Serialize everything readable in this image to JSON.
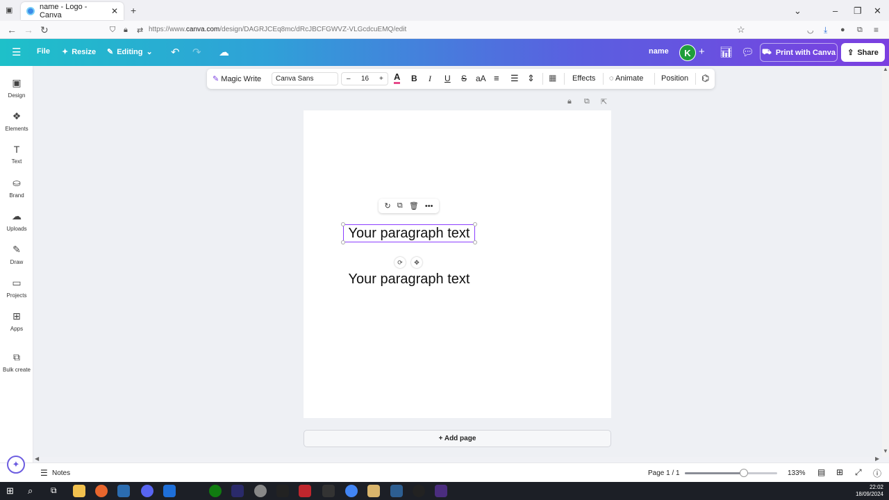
{
  "browser": {
    "tab_title": "name - Logo - Canva",
    "tab_close": "✕",
    "new_tab": "+",
    "url_prefix": "https://www.",
    "url_domain": "canva.com",
    "url_path": "/design/DAGRJCEq8mc/dRcJBCFGWVZ-VLGcdcuEMQ/edit"
  },
  "header": {
    "file_label": "File",
    "resize_label": "Resize",
    "editing_label": "Editing",
    "design_name": "name",
    "avatar_initial": "K",
    "print_label": "Print with Canva",
    "share_label": "Share"
  },
  "sidebar": {
    "items": [
      {
        "label": "Design",
        "icon": "design-icon"
      },
      {
        "label": "Elements",
        "icon": "elements-icon"
      },
      {
        "label": "Text",
        "icon": "text-icon"
      },
      {
        "label": "Brand",
        "icon": "brand-icon"
      },
      {
        "label": "Uploads",
        "icon": "uploads-icon"
      },
      {
        "label": "Draw",
        "icon": "draw-icon"
      },
      {
        "label": "Projects",
        "icon": "projects-icon"
      },
      {
        "label": "Apps",
        "icon": "apps-icon"
      },
      {
        "label": "Bulk create",
        "icon": "bulk-create-icon"
      }
    ]
  },
  "text_toolbar": {
    "magic_write": "Magic Write",
    "font_name": "Canva Sans",
    "font_size": "16",
    "minus": "–",
    "plus": "+",
    "bold": "B",
    "italic": "I",
    "underline": "U",
    "strike": "S",
    "case": "aA",
    "effects": "Effects",
    "animate": "Animate",
    "position": "Position"
  },
  "canvas": {
    "selected_text": "Your paragraph text",
    "second_text": "Your paragraph text",
    "add_page": "+ Add page"
  },
  "bottom_bar": {
    "notes": "Notes",
    "page_indicator": "Page 1 / 1",
    "zoom": "133%",
    "zoom_level": 0.64
  },
  "taskbar": {
    "time": "22:02",
    "date": "18/09/2024"
  },
  "colors": {
    "accent": "#8b3dff",
    "header_start": "#1ec0c9",
    "header_end": "#7b3fe0"
  }
}
